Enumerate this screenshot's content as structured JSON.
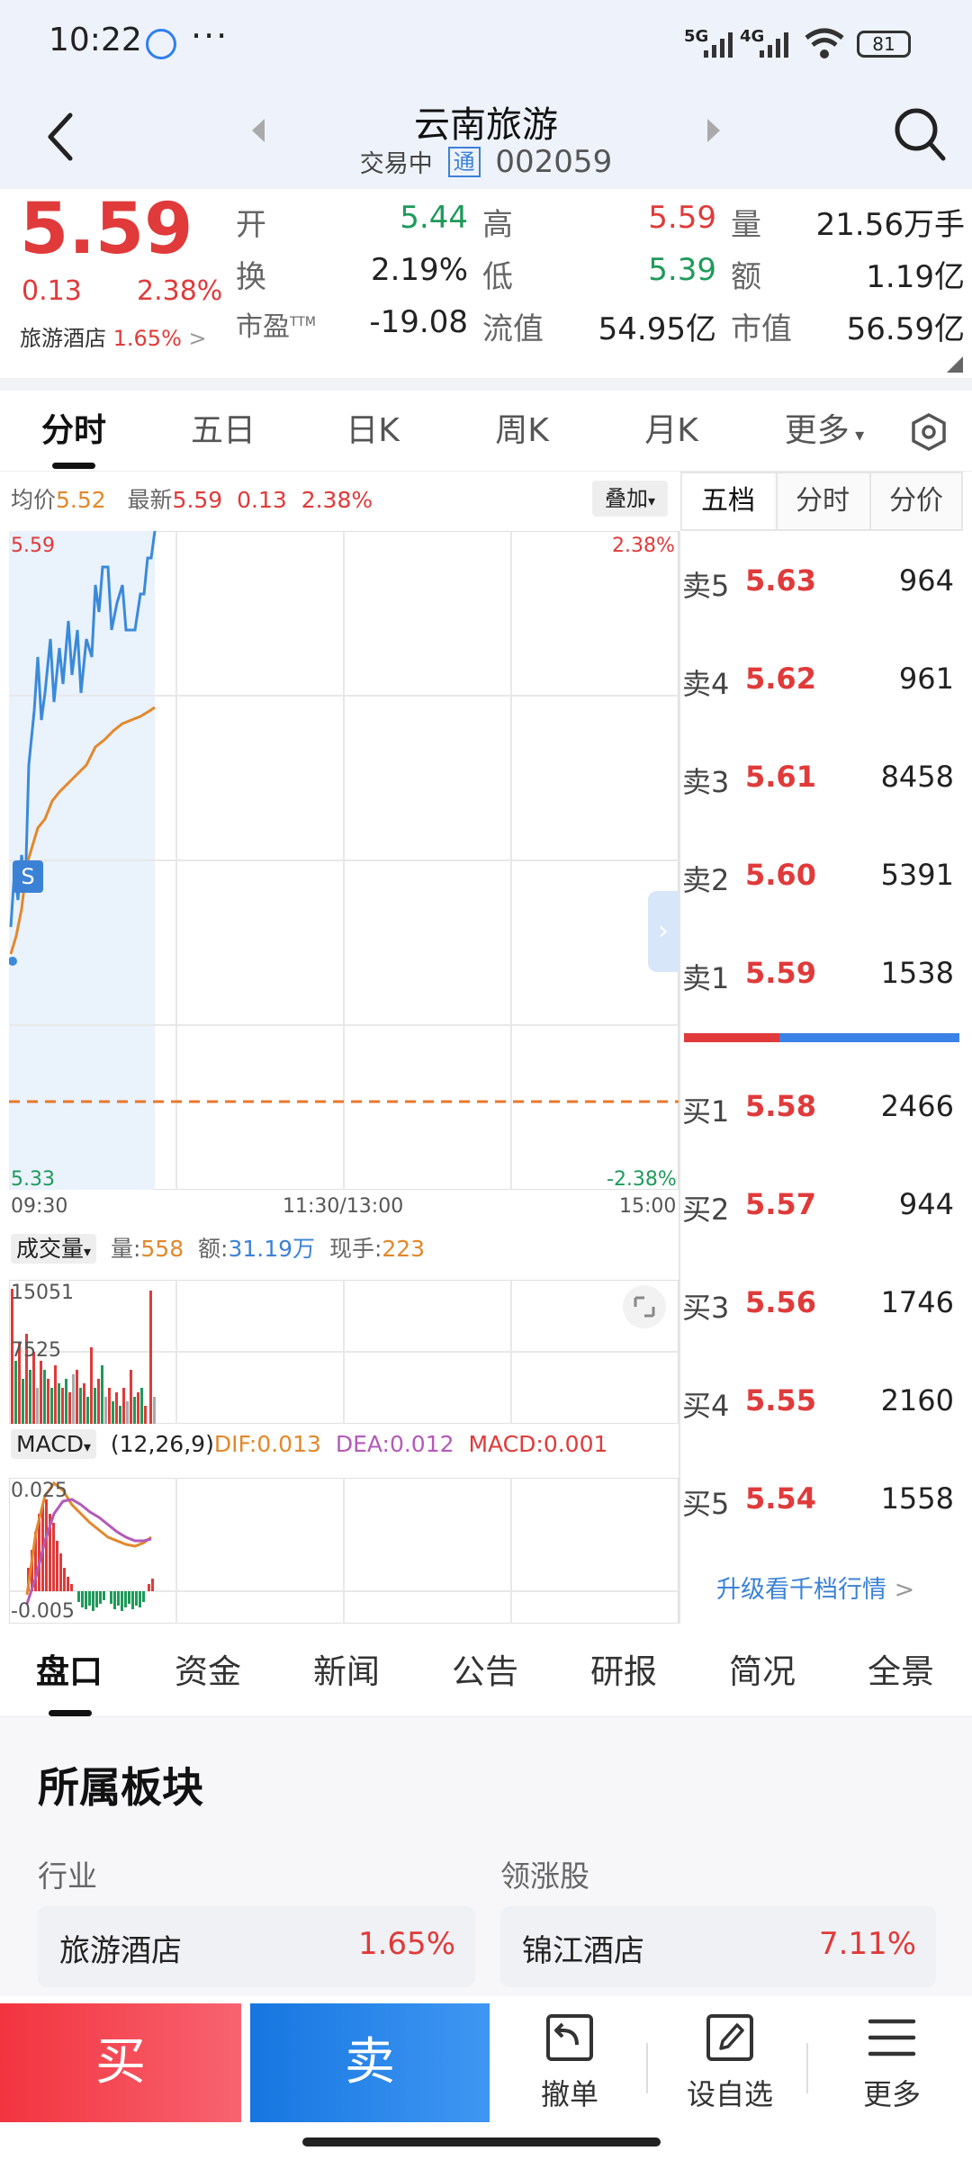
{
  "status": {
    "time": "10:22",
    "sig1": "5G",
    "sig2": "4G",
    "battery": "81"
  },
  "header": {
    "stock_name": "云南旅游",
    "trading_status": "交易中",
    "tong_badge": "通",
    "stock_code": "002059"
  },
  "quote": {
    "price": "5.59",
    "change": "0.13",
    "change_pct": "2.38%",
    "sector_name": "旅游酒店",
    "sector_pct": "1.65%",
    "open_label": "开",
    "open": "5.44",
    "high_label": "高",
    "high": "5.59",
    "vol_label": "量",
    "vol": "21.56万手",
    "turnover_label": "换",
    "turnover": "2.19%",
    "low_label": "低",
    "low": "5.39",
    "amount_label": "额",
    "amount": "1.19亿",
    "pe_label": "市盈",
    "pe_sup": "TTM",
    "pe": "-19.08",
    "float_label": "流值",
    "float_cap": "54.95亿",
    "mcap_label": "市值",
    "mcap": "56.59亿"
  },
  "tabs": [
    "分时",
    "五日",
    "日K",
    "周K",
    "月K",
    "更多"
  ],
  "chart": {
    "avg_label": "均价",
    "avg": "5.52",
    "latest_label": "最新",
    "latest": "5.59",
    "latest_chg": "0.13",
    "latest_pct": "2.38%",
    "overlay_btn": "叠加",
    "y_top": "5.59",
    "y_bottom": "5.33",
    "pct_top": "2.38%",
    "pct_bottom": "-2.38%",
    "t_start": "09:30",
    "t_mid": "11:30/13:00",
    "t_end": "15:00",
    "s_marker": "S",
    "vol_dropdown": "成交量",
    "vol_qty_label": "量:",
    "vol_qty": "558",
    "vol_amt_label": "额:",
    "vol_amt": "31.19万",
    "vol_hand_label": "现手:",
    "vol_hand": "223",
    "vol_top": "15051",
    "vol_mid": "7525",
    "macd_dropdown": "MACD",
    "macd_params": "(12,26,9)",
    "dif_label": "DIF:",
    "dif": "0.013",
    "dea_label": "DEA:",
    "dea": "0.012",
    "macd_label": "MACD:",
    "macd": "0.001",
    "macd_top": "0.025",
    "macd_bottom": "-0.005"
  },
  "orderbook": {
    "tabs": [
      "五档",
      "分时",
      "分价"
    ],
    "sells": [
      {
        "label": "卖5",
        "price": "5.63",
        "vol": "964"
      },
      {
        "label": "卖4",
        "price": "5.62",
        "vol": "961"
      },
      {
        "label": "卖3",
        "price": "5.61",
        "vol": "8458"
      },
      {
        "label": "卖2",
        "price": "5.60",
        "vol": "5391"
      },
      {
        "label": "卖1",
        "price": "5.59",
        "vol": "1538"
      }
    ],
    "buys": [
      {
        "label": "买1",
        "price": "5.58",
        "vol": "2466"
      },
      {
        "label": "买2",
        "price": "5.57",
        "vol": "944"
      },
      {
        "label": "买3",
        "price": "5.56",
        "vol": "1746"
      },
      {
        "label": "买4",
        "price": "5.55",
        "vol": "2160"
      },
      {
        "label": "买5",
        "price": "5.54",
        "vol": "1558"
      }
    ],
    "upgrade_link": "升级看千档行情"
  },
  "bottom_tabs": [
    "盘口",
    "资金",
    "新闻",
    "公告",
    "研报",
    "简况",
    "全景"
  ],
  "sector": {
    "title": "所属板块",
    "industry_label": "行业",
    "leader_label": "领涨股",
    "industry_name": "旅游酒店",
    "industry_pct": "1.65%",
    "leader_name": "锦江酒店",
    "leader_pct": "7.11%"
  },
  "actions": {
    "buy": "买",
    "sell": "卖",
    "cancel": "撤单",
    "watchlist": "设自选",
    "more": "更多"
  },
  "colors": {
    "up": "#e03a3a",
    "down": "#1e9a5a",
    "price_line": "#3b8ad9",
    "avg_line": "#e2882b",
    "buy": "#f2343f",
    "sell": "#1676e0"
  }
}
